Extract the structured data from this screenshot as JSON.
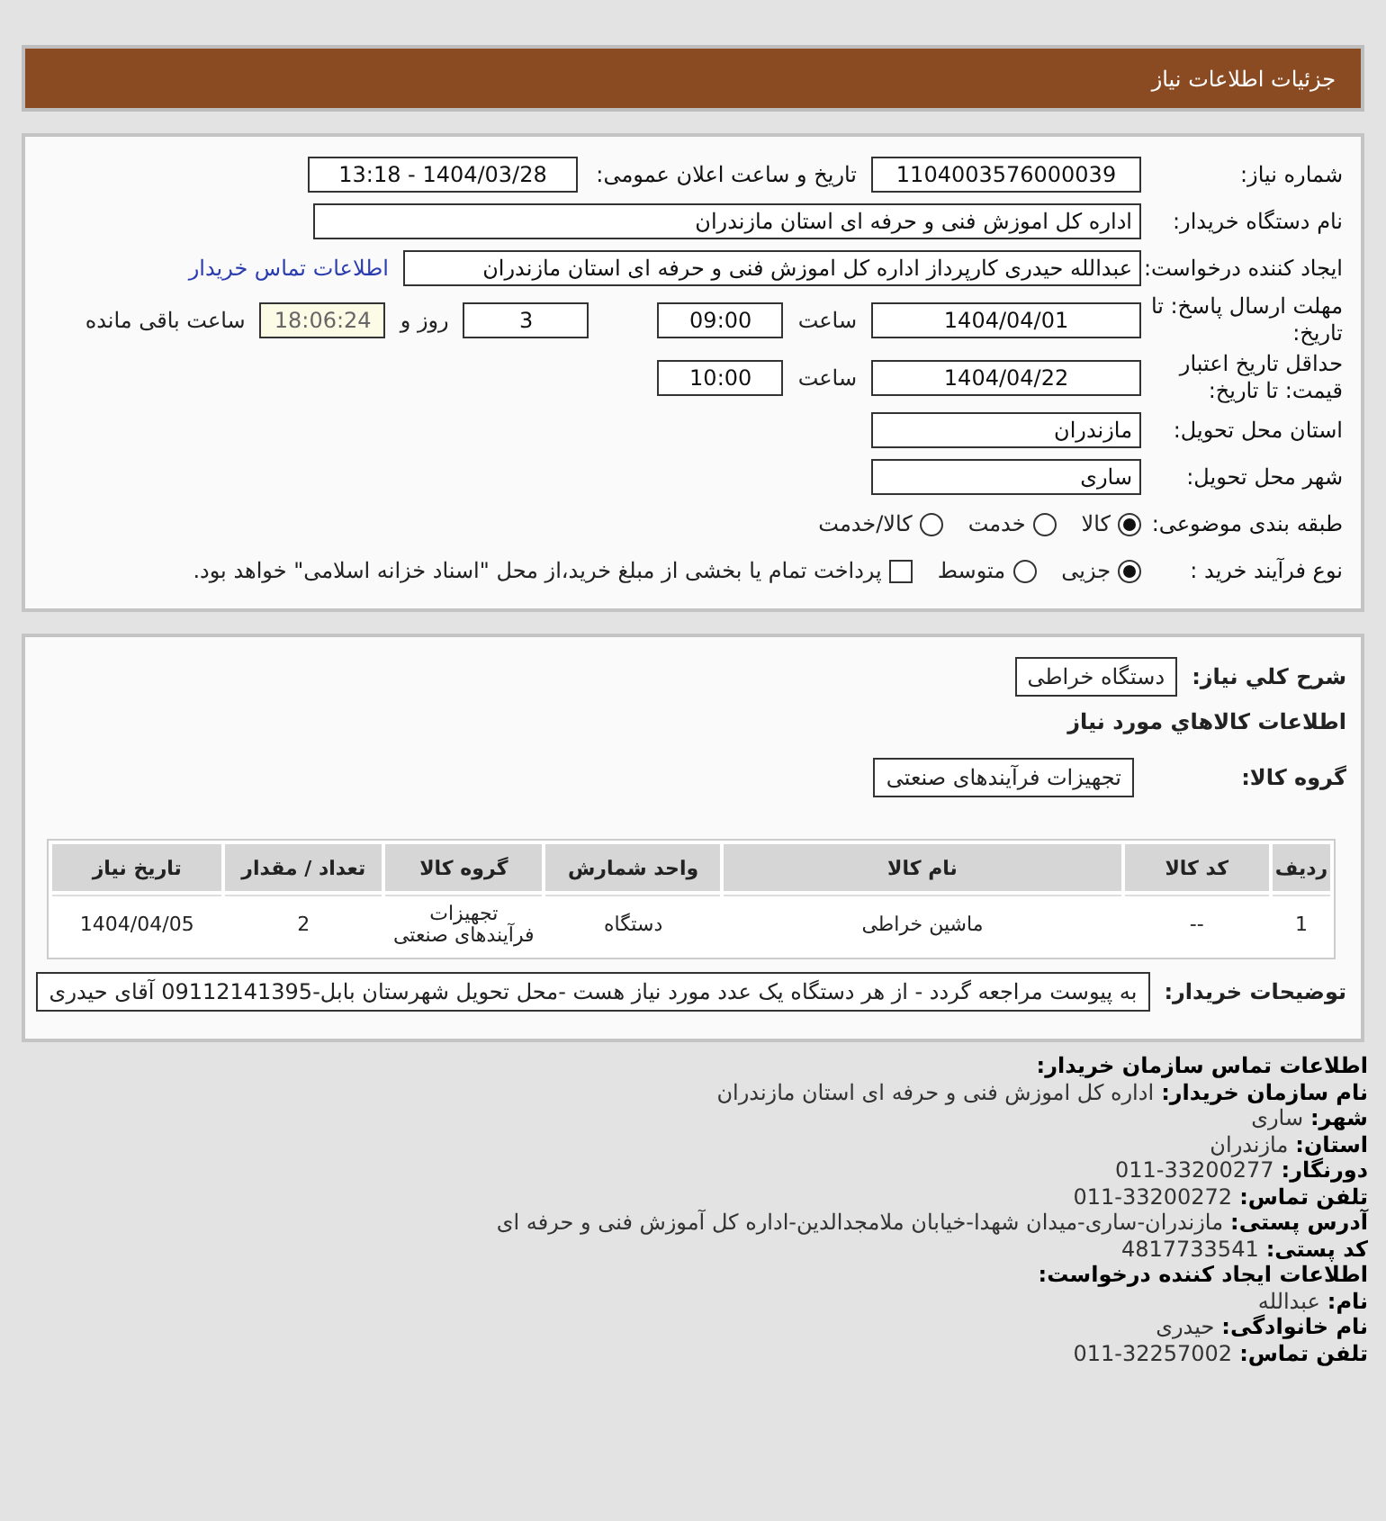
{
  "header": {
    "title": "جزئیات اطلاعات نیاز"
  },
  "need_number": {
    "label": "شماره نیاز:",
    "value": "1104003576000039"
  },
  "announce": {
    "label": "تاریخ و ساعت اعلان عمومی:",
    "value": "1404/03/28 - 13:18"
  },
  "buyer_org": {
    "label": "نام دستگاه خریدار:",
    "value": "اداره کل اموزش فنی و حرفه ای استان مازندران"
  },
  "requester": {
    "label": "ایجاد کننده درخواست:",
    "value": "عبدالله حیدری کارپرداز اداره کل اموزش فنی و حرفه ای استان مازندران",
    "link": "اطلاعات تماس خریدار"
  },
  "deadline": {
    "label": "مهلت ارسال پاسخ: تا تاریخ:",
    "date": "1404/04/01",
    "time_label": "ساعت",
    "time": "09:00",
    "days": "3",
    "days_label": "روز و",
    "countdown": "18:06:24",
    "countdown_label": "ساعت باقی مانده"
  },
  "validity": {
    "label": "حداقل تاریخ اعتبار قیمت: تا تاریخ:",
    "date": "1404/04/22",
    "time_label": "ساعت",
    "time": "10:00"
  },
  "province": {
    "label": "استان محل تحویل:",
    "value": "مازندران"
  },
  "city": {
    "label": "شهر محل تحویل:",
    "value": "ساری"
  },
  "category": {
    "label": "طبقه بندی موضوعی:",
    "options": [
      {
        "label": "کالا",
        "selected": true
      },
      {
        "label": "خدمت",
        "selected": false
      },
      {
        "label": "کالا/خدمت",
        "selected": false
      }
    ]
  },
  "process": {
    "label": "نوع فرآیند خرید :",
    "options": [
      {
        "label": "جزیی",
        "selected": true
      },
      {
        "label": "متوسط",
        "selected": false
      }
    ],
    "treasury": {
      "label": "پرداخت تمام یا بخشی از مبلغ خرید،از محل \"اسناد خزانه اسلامی\" خواهد بود.",
      "checked": false
    }
  },
  "summary": {
    "label": "شرح کلي نياز:",
    "value": "دستگاه خراطی"
  },
  "goods_heading": "اطلاعات کالاهاي مورد نياز",
  "goods_group": {
    "label": "گروه کالا:",
    "value": "تجهیزات فرآیندهای صنعتی"
  },
  "table": {
    "columns": [
      "ردیف",
      "کد کالا",
      "نام کالا",
      "واحد شمارش",
      "گروه کالا",
      "تعداد / مقدار",
      "تاریخ نیاز"
    ],
    "rows": [
      [
        "1",
        "--",
        "ماشین خراطی",
        "دستگاه",
        "تجهیزات فرآیندهای صنعتی",
        "2",
        "1404/04/05"
      ]
    ]
  },
  "buyer_notes": {
    "label": "توضیحات خریدار:",
    "value": "به پیوست مراجعه گردد - از هر دستگاه یک عدد مورد نیاز هست -محل تحویل شهرستان بابل-09112141395 آقای حیدری"
  },
  "contact": {
    "heading": "اطلاعات تماس سازمان خریدار:",
    "lines": [
      {
        "label": "نام سازمان خریدار:",
        "value": "اداره کل اموزش فنی و حرفه ای استان مازندران"
      },
      {
        "label": "شهر:",
        "value": "ساری"
      },
      {
        "label": "استان:",
        "value": "مازندران"
      },
      {
        "label": "دورنگار:",
        "value": "011-33200277"
      },
      {
        "label": "تلفن تماس:",
        "value": "011-33200272"
      },
      {
        "label": "آدرس پستی:",
        "value": "مازندران-ساری-میدان شهدا-خیابان ملامجدالدین-اداره کل آموزش فنی و حرفه ای"
      },
      {
        "label": "کد پستی:",
        "value": "4817733541"
      }
    ],
    "creator_heading": "اطلاعات ایجاد کننده درخواست:",
    "creator_lines": [
      {
        "label": "نام:",
        "value": "عبدالله"
      },
      {
        "label": "نام خانوادگی:",
        "value": "حیدری"
      },
      {
        "label": "تلفن تماس:",
        "value": "011-32257002"
      }
    ]
  }
}
